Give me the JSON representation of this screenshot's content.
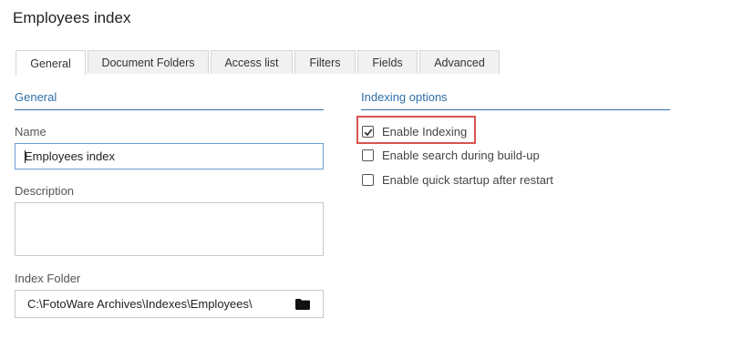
{
  "page": {
    "title": "Employees index"
  },
  "tabs": [
    {
      "label": "General",
      "active": true
    },
    {
      "label": "Document Folders",
      "active": false
    },
    {
      "label": "Access list",
      "active": false
    },
    {
      "label": "Filters",
      "active": false
    },
    {
      "label": "Fields",
      "active": false
    },
    {
      "label": "Advanced",
      "active": false
    }
  ],
  "general": {
    "header": "General",
    "name_label": "Name",
    "name_value": "Employees index",
    "description_label": "Description",
    "description_value": "",
    "folder_label": "Index Folder",
    "folder_value": "C:\\FotoWare Archives\\Indexes\\Employees\\",
    "folder_icon": "folder-icon"
  },
  "indexing": {
    "header": "Indexing options",
    "options": [
      {
        "label": "Enable Indexing",
        "checked": true
      },
      {
        "label": "Enable search during build-up",
        "checked": false
      },
      {
        "label": "Enable quick startup after restart",
        "checked": false
      }
    ]
  },
  "colors": {
    "accent": "#2f6fa8",
    "highlight": "#d9534f"
  }
}
